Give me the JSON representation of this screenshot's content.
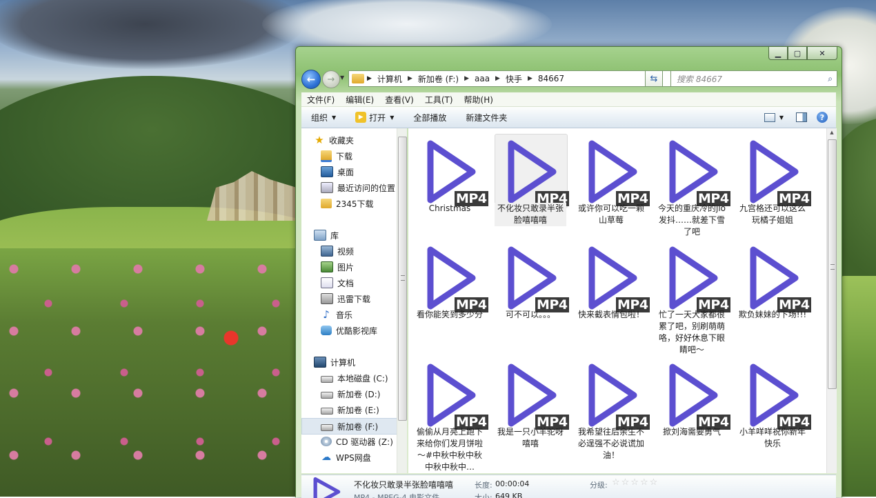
{
  "window": {
    "caption_buttons": [
      "minimize-icon",
      "maximize-icon",
      "close-icon"
    ]
  },
  "address": {
    "crumbs": [
      "计算机",
      "新加卷 (F:)",
      "aaa",
      "快手",
      "84667"
    ]
  },
  "search": {
    "placeholder": "搜索 84667"
  },
  "menu": [
    "文件(F)",
    "编辑(E)",
    "查看(V)",
    "工具(T)",
    "帮助(H)"
  ],
  "toolbar": {
    "organize": "组织",
    "open": "打开",
    "play_all": "全部播放",
    "new_folder": "新建文件夹"
  },
  "nav": {
    "favorites": {
      "label": "收藏夹",
      "items": [
        "下载",
        "桌面",
        "最近访问的位置",
        "2345下载"
      ]
    },
    "libraries": {
      "label": "库",
      "items": [
        "视频",
        "图片",
        "文档",
        "迅雷下载",
        "音乐",
        "优酷影视库"
      ]
    },
    "computer": {
      "label": "计算机",
      "items": [
        "本地磁盘 (C:)",
        "新加卷 (D:)",
        "新加卷 (E:)",
        "新加卷 (F:)",
        "CD 驱动器 (Z:)",
        "WPS网盘"
      ],
      "selected": "新加卷 (F:)"
    }
  },
  "files": {
    "badge": "MP4",
    "accent": "#5c4fd0",
    "items": [
      "Christmas",
      "不化妆只敢录半张脸嘻嘻嘻",
      "或许你可以吃一颗山草莓",
      "今天的重庆冷的jio发抖……就差下雪了吧",
      "九宫格还可以这么玩橘子姐姐",
      "看你能笑到多少分",
      "可不可以。。。",
      "快来截表情包啦！",
      "忙了一天大家都很累了吧，别刷萌萌咯，好好休息下眼睛吧～",
      "欺负妹妹的下场!!!",
      "偷偷从月亮上跑下来给你们发月饼啦～#中秋中秋中秋中秋中秋中…",
      "我是一只小羊驼呀嘻嘻",
      "我希望往后余生不必逞强不必说谎加油！",
      "掀刘海需要勇气",
      "小羊咩咩祝你新年快乐"
    ],
    "selected_index": 1
  },
  "details": {
    "name": "不化妆只敢录半张脸嘻嘻嘻",
    "length_label": "长度:",
    "length_value": "00:00:04",
    "rating_label": "分级:",
    "stars": "☆☆☆☆☆",
    "type": "MP4 - MPEG-4 电影文件",
    "size_label": "大小:",
    "size_value": "649 KB"
  }
}
